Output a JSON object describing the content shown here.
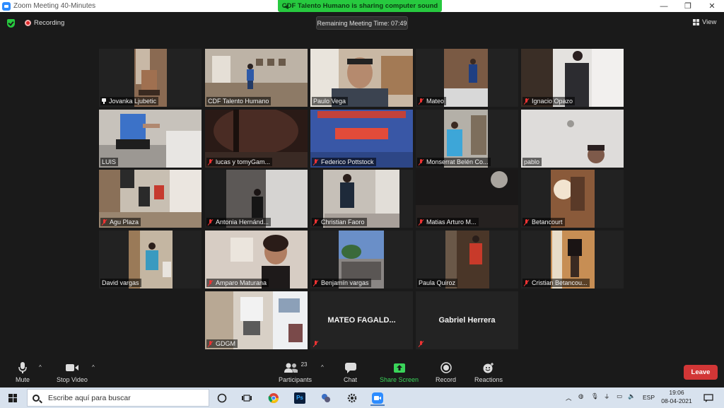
{
  "window": {
    "title": "Zoom Meeting 40-Minutes",
    "minimize": "—",
    "maximize": "❐",
    "close": "✕"
  },
  "share_banner": {
    "text": "CDF Talento Humano is sharing computer sound"
  },
  "meeting_bar": {
    "recording_label": "Recording",
    "timer": "Remaining Meeting Time: 07:49",
    "view_label": "View"
  },
  "participants": [
    {
      "name": "Jovanka Ljubetic",
      "muted": false,
      "pinned": true,
      "active": true
    },
    {
      "name": "CDF Talento Humano",
      "muted": false
    },
    {
      "name": "Paulo Vega",
      "muted": false
    },
    {
      "name": "Mateo",
      "muted": true
    },
    {
      "name": "Ignacio Opazo",
      "muted": true
    },
    {
      "name": "LUIS",
      "muted": false
    },
    {
      "name": "lucas y tomyGam...",
      "muted": true
    },
    {
      "name": "Federico Pottstock",
      "muted": true
    },
    {
      "name": "Monserrat Belén Co...",
      "muted": true
    },
    {
      "name": "pablo",
      "muted": false
    },
    {
      "name": "Agu Plaza",
      "muted": true
    },
    {
      "name": "Antonia Hernánd...",
      "muted": true
    },
    {
      "name": "Christian Faoro",
      "muted": true
    },
    {
      "name": "Matias Arturo M...",
      "muted": true
    },
    {
      "name": "Betancourt",
      "muted": true
    },
    {
      "name": "David vargas",
      "muted": false
    },
    {
      "name": "Amparo Maturana",
      "muted": true
    },
    {
      "name": "Benjamín vargas",
      "muted": true
    },
    {
      "name": "Paula Quiroz",
      "muted": false
    },
    {
      "name": "Cristian Betancou...",
      "muted": true
    },
    {
      "name": "GDGM",
      "muted": true
    },
    {
      "name": "MATEO FAGALD...",
      "muted": true,
      "video_off": true
    },
    {
      "name": "Gabriel Herrera",
      "muted": true,
      "video_off": true
    }
  ],
  "toolbar": {
    "mute_label": "Mute",
    "stop_video_label": "Stop Video",
    "participants_label": "Participants",
    "participants_count": "23",
    "chat_label": "Chat",
    "share_screen_label": "Share Screen",
    "record_label": "Record",
    "reactions_label": "Reactions",
    "leave_label": "Leave",
    "caret": "^"
  },
  "taskbar": {
    "search_placeholder": "Escribe aquí para buscar",
    "language": "ESP",
    "time": "19:06",
    "date": "08-04-2021",
    "ps_label": "Ps"
  },
  "colors": {
    "active_speaker": "#c6e45a",
    "share_banner": "#27c93f",
    "leave": "#d23636",
    "muted": "#e33333",
    "share_screen": "#3ad55a"
  }
}
